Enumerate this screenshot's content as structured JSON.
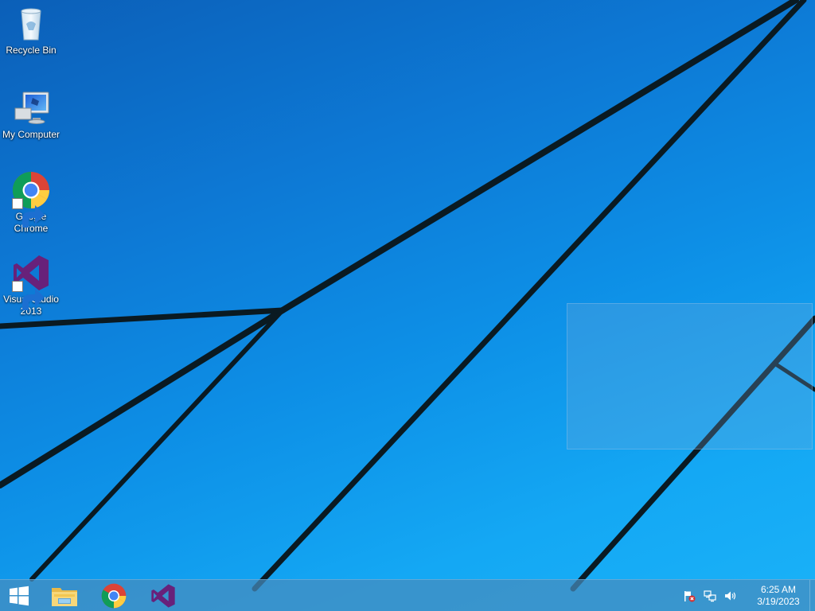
{
  "desktop": {
    "icons": [
      {
        "label": "Recycle Bin",
        "icon": "recycle-bin-icon"
      },
      {
        "label": "My Computer",
        "icon": "computer-icon"
      },
      {
        "label": "Google Chrome",
        "icon": "chrome-icon"
      },
      {
        "label": "Visual Studio 2013",
        "icon": "visual-studio-icon"
      }
    ]
  },
  "taskbar": {
    "start": {
      "icon": "windows-logo-icon"
    },
    "pinned": [
      {
        "icon": "file-explorer-icon"
      },
      {
        "icon": "chrome-icon"
      },
      {
        "icon": "visual-studio-icon"
      }
    ],
    "tray": {
      "icons": [
        "action-center-flag-icon",
        "network-icon",
        "volume-icon"
      ],
      "time": "6:25 AM",
      "date": "3/19/2023"
    }
  },
  "colors": {
    "wallpaper": "#0d8fe6",
    "taskbar": "#468cbe",
    "visual_studio": "#68217a"
  }
}
